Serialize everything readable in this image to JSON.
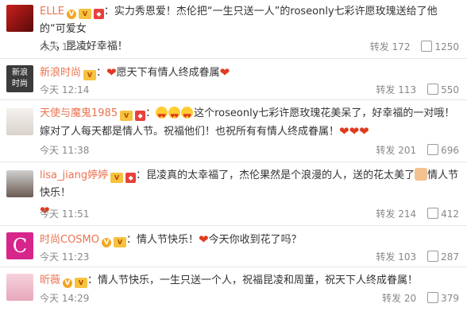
{
  "colors": {
    "username": "#eb7350",
    "heart": "#e03a1e",
    "meta": "#888888"
  },
  "posts": [
    {
      "username": "ELLE",
      "segments": [
        "：实力秀恩爱！杰伦把“一生只送一人”的roseonly七彩许愿玫瑰送给了他的“可爱女",
        "人”，昆凌好幸福！"
      ],
      "time": "今天 12:00",
      "repost_label": "转发",
      "repost_count": "172",
      "like_count": "1250"
    },
    {
      "username": "新浪时尚",
      "avatar_text_line1": "新浪",
      "avatar_text_line2": "时尚",
      "text": "愿天下有情人终成眷属",
      "time": "今天 12:14",
      "repost_label": "转发",
      "repost_count": "113",
      "like_count": "550"
    },
    {
      "username": "天使与魔鬼1985",
      "text_a": "这个roseonly七彩许愿玫瑰花美呆了，好幸福的一对哦！",
      "text_b": "嫁对了人每天都是情人节。祝福他们！也祝所有有情人终成眷属！",
      "time": "今天 11:38",
      "repost_label": "转发",
      "repost_count": "201",
      "like_count": "696"
    },
    {
      "username": "lisa_jiang婷婷",
      "text": "：昆凌真的太幸福了，杰伦果然是个浪漫的人，送的花太美了",
      "text_after": "情人节快乐！",
      "time": "今天 11:51",
      "repost_label": "转发",
      "repost_count": "214",
      "like_count": "412"
    },
    {
      "username": "时尚COSMO",
      "avatar_text": "C",
      "text_a": "：情人节快乐！",
      "text_b": "今天你收到花了吗？",
      "time": "今天 11:23",
      "repost_label": "转发",
      "repost_count": "103",
      "like_count": "287"
    },
    {
      "username": "昕薇",
      "text": "：情人节快乐，一生只送一个人，祝福昆凌和周董，祝天下人终成眷属！",
      "time": "今天 14:29",
      "repost_label": "转发",
      "repost_count": "20",
      "like_count": "379"
    }
  ]
}
